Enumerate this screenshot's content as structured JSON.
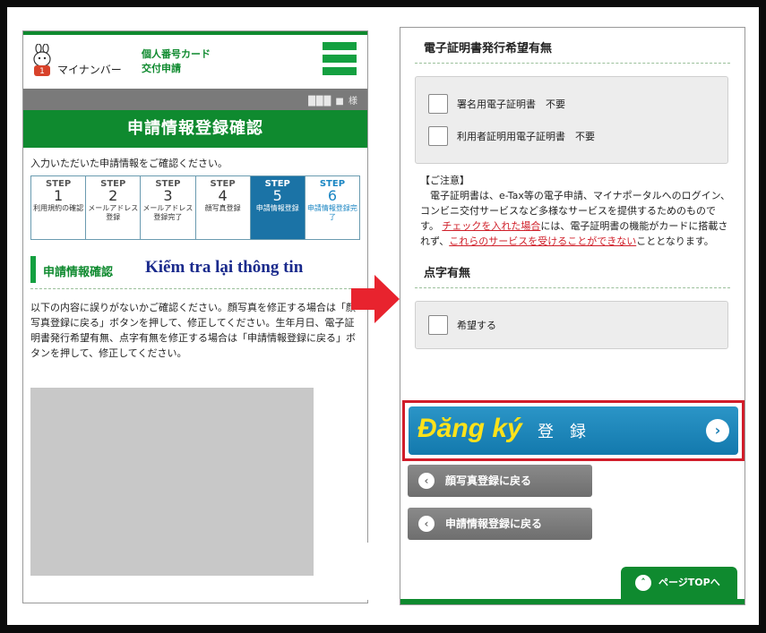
{
  "left": {
    "logo_text": "マイナンバー",
    "logo_sub_line1": "個人番号カード",
    "logo_sub_line2": "交付申請",
    "user_label": "███ ■ 様",
    "page_title": "申請情報登録確認",
    "intro": "入力いただいた申請情報をご確認ください。",
    "steps": [
      {
        "label": "STEP",
        "num": "1",
        "desc": "利用規約の確認"
      },
      {
        "label": "STEP",
        "num": "2",
        "desc": "メールアドレス登録"
      },
      {
        "label": "STEP",
        "num": "3",
        "desc": "メールアドレス登録完了"
      },
      {
        "label": "STEP",
        "num": "4",
        "desc": "顔写真登録"
      },
      {
        "label": "STEP",
        "num": "5",
        "desc": "申請情報登録"
      },
      {
        "label": "STEP",
        "num": "6",
        "desc": "申請情報登録完了"
      }
    ],
    "section_jp": "申請情報確認",
    "section_vn": "Kiểm tra lại thông tin",
    "body_text": "以下の内容に誤りがないかご確認ください。顔写真を修正する場合は「顔写真登録に戻る」ボタンを押して、修正してください。生年月日、電子証明書発行希望有無、点字有無を修正する場合は「申請情報登録に戻る」ボタンを押して、修正してください。"
  },
  "right": {
    "cert_heading": "電子証明書発行希望有無",
    "cert_options": [
      {
        "label": "署名用電子証明書　不要"
      },
      {
        "label": "利用者証明用電子証明書　不要"
      }
    ],
    "notice_title": "【ご注意】",
    "notice_body": "　電子証明書は、e-Tax等の電子申請、マイナポータルへのログイン、コンビニ交付サービスなど多様なサービスを提供するためのものです。",
    "notice_red1": "チェックを入れた場合",
    "notice_mid": "には、電子証明書の機能がカードに搭載されず、",
    "notice_red2": "これらのサービスを受けることができない",
    "notice_end": "こととなります。",
    "braille_heading": "点字有無",
    "braille_option": "希望する",
    "register_vn": "Đăng ký",
    "register_jp": "登録",
    "back_photo": "顔写真登録に戻る",
    "back_info": "申請情報登録に戻る",
    "page_top": "ページTOPへ"
  },
  "colors": {
    "green": "#0f8a2f",
    "blue_active": "#1b73a6",
    "red_highlight": "#d11d2a",
    "vn_yellow": "#ffe21a"
  }
}
